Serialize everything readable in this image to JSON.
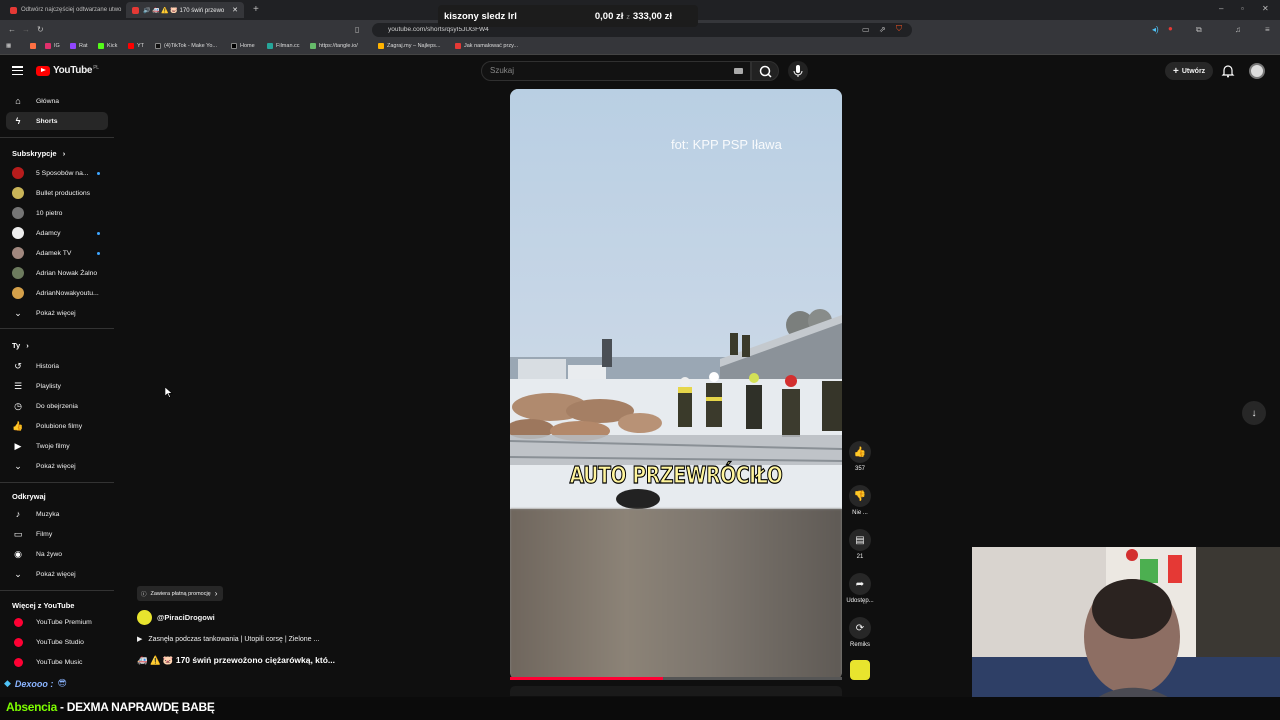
{
  "browser": {
    "tabs": [
      {
        "label": "Odtwórz najczęściej odtwarzane utwo"
      },
      {
        "label": "🔊 🚑 ⚠️ 🐷 170 świń przewoż",
        "active": true
      }
    ],
    "url": "youtube.com/shorts/qsyI5JUGFW4",
    "bookmarks": [
      "IG",
      "Rat",
      "Kick",
      "YT",
      "(4)TikTok - Make Yo...",
      "Home",
      "Filman.cc",
      "https://tangle.io/",
      "Zagraj.my – Najleps...",
      "Jak namalować przy..."
    ]
  },
  "stream_top": {
    "song": "kiszony sledz lrl",
    "current": "0,00 zł",
    "goal": "333,00 zł",
    "separator": "z"
  },
  "header": {
    "logo": "YouTube",
    "region": "PL",
    "search_placeholder": "Szukaj",
    "create_label": "Utwórz"
  },
  "sidebar": {
    "main": [
      {
        "label": "Główna",
        "icon": "home-icon"
      },
      {
        "label": "Shorts",
        "icon": "shorts-icon",
        "active": true
      }
    ],
    "subs_title": "Subskrypcje",
    "subs": [
      {
        "label": "5 Sposobów na...",
        "color": "#b71c1c",
        "dot": true
      },
      {
        "label": "Bullet productions",
        "color": "#c9b458",
        "dot": false
      },
      {
        "label": "10 pietro",
        "color": "#757575",
        "dot": false
      },
      {
        "label": "Adamcy",
        "color": "#eeeeee",
        "dot": true
      },
      {
        "label": "Adamek TV",
        "color": "#a1887f",
        "dot": true
      },
      {
        "label": "Adrian Nowak Żalno",
        "color": "#6d7b5e",
        "dot": false
      },
      {
        "label": "AdrianNowakyoutu...",
        "color": "#d4a04a",
        "dot": false
      }
    ],
    "subs_more": "Pokaż więcej",
    "you_title": "Ty",
    "you": [
      {
        "label": "Historia",
        "icon": "history-icon",
        "glyph": "↺"
      },
      {
        "label": "Playlisty",
        "icon": "playlist-icon",
        "glyph": "☰"
      },
      {
        "label": "Do obejrzenia",
        "icon": "watch-later-icon",
        "glyph": "◷"
      },
      {
        "label": "Polubione filmy",
        "icon": "like-icon",
        "glyph": "👍"
      },
      {
        "label": "Twoje filmy",
        "icon": "your-videos-icon",
        "glyph": "▶"
      }
    ],
    "you_more": "Pokaż więcej",
    "explore_title": "Odkrywaj",
    "explore": [
      {
        "label": "Muzyka",
        "icon": "music-icon",
        "glyph": "♪"
      },
      {
        "label": "Filmy",
        "icon": "film-icon",
        "glyph": "▭"
      },
      {
        "label": "Na żywo",
        "icon": "live-icon",
        "glyph": "◉"
      }
    ],
    "explore_more": "Pokaż więcej",
    "more_title": "Więcej z YouTube",
    "more": [
      {
        "label": "YouTube Premium"
      },
      {
        "label": "YouTube Studio"
      },
      {
        "label": "YouTube Music"
      }
    ]
  },
  "video": {
    "watermark": "fot: KPP PSP Iława",
    "caption": "AUTO PRZEWRÓCIŁO",
    "progress": 0.46
  },
  "actions": {
    "likes": "357",
    "dislike": "Nie ...",
    "comments": "21",
    "share": "Udostęp...",
    "remix": "Remiks"
  },
  "info": {
    "promo": "Zawiera płatną promocję",
    "channel": "@PiraciDrogowi",
    "related": "Zasnęła podczas tankowania | Utopili corsę | Zielone ...",
    "title": "🚑 ⚠️ 🐷 170 świń przewożono ciężarówką, któ..."
  },
  "stream_bottom": {
    "chat_user": "Dexooo :",
    "ticker_prefix": "Absencia",
    "ticker": " - DEXMA NAPRAWDĘ BABĘ"
  },
  "colors": {
    "accent": "#ff0033",
    "bg": "#0f0f0f"
  }
}
